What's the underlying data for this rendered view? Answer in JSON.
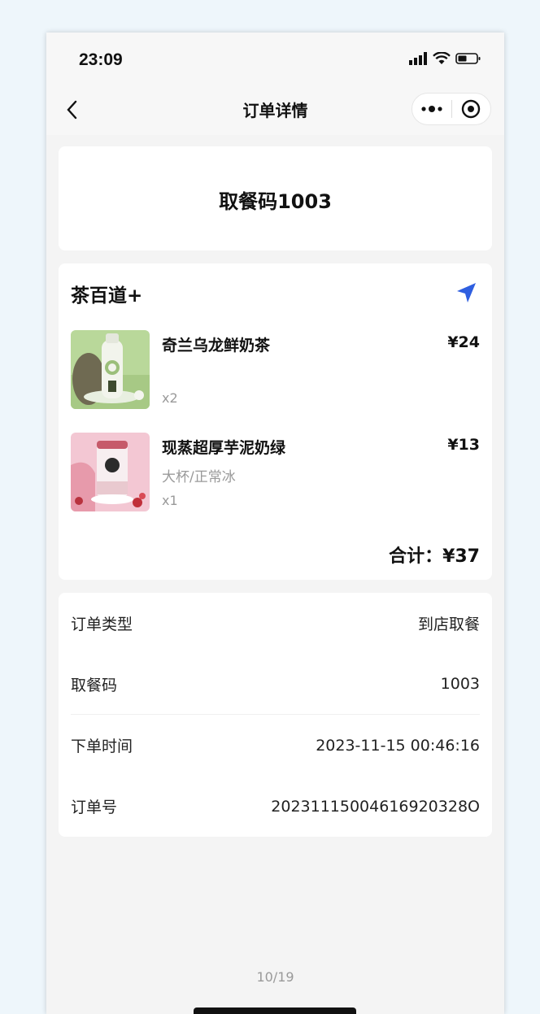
{
  "status_bar": {
    "time": "23:09"
  },
  "nav": {
    "title": "订单详情"
  },
  "pickup": {
    "text": "取餐码1003"
  },
  "order": {
    "shop_name": "茶百道+",
    "items": [
      {
        "name": "奇兰乌龙鲜奶茶",
        "price": "¥24",
        "spec": "",
        "qty": "x2"
      },
      {
        "name": "现蒸超厚芋泥奶绿",
        "price": "¥13",
        "spec": "大杯/正常冰",
        "qty": "x1"
      }
    ],
    "total": "合计：¥37"
  },
  "info": {
    "rows": [
      {
        "label": "订单类型",
        "value": "到店取餐"
      },
      {
        "label": "取餐码",
        "value": "1003"
      },
      {
        "label": "下单时间",
        "value": "2023-11-15 00:46:16"
      },
      {
        "label": "订单号",
        "value": "20231115004616920328O"
      }
    ]
  },
  "pager": {
    "text": "10/19"
  },
  "colors": {
    "accent": "#2f5fe0",
    "background": "#f4f4f4",
    "card": "#ffffff"
  }
}
